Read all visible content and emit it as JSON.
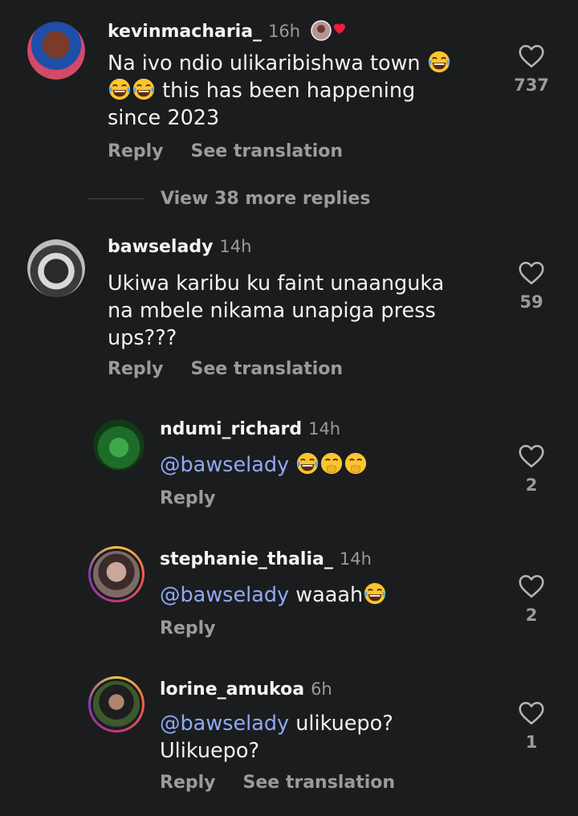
{
  "comments": [
    {
      "username": "kevinmacharia_",
      "time": "16h",
      "text_lines": [
        "Na ivo ndio ulikaribishwa town",
        "this has been happening",
        "since 2023"
      ],
      "likes": "737",
      "reply_label": "Reply",
      "translate_label": "See translation"
    },
    {
      "username": "bawselady",
      "time": "14h",
      "text": "Ukiwa karibu ku faint unaanguka na mbele nikama unapiga press ups???",
      "likes": "59",
      "reply_label": "Reply",
      "translate_label": "See translation"
    }
  ],
  "view_more_label": "View 38 more replies",
  "replies": [
    {
      "username": "ndumi_richard",
      "time": "14h",
      "mention": "@bawselady",
      "text": "",
      "likes": "2",
      "reply_label": "Reply"
    },
    {
      "username": "stephanie_thalia_",
      "time": "14h",
      "mention": "@bawselady",
      "text": "waaah",
      "likes": "2",
      "reply_label": "Reply"
    },
    {
      "username": "lorine_amukoa",
      "time": "6h",
      "mention": "@bawselady",
      "text": "ulikuepo?",
      "text2": "Ulikuepo?",
      "likes": "1",
      "reply_label": "Reply",
      "translate_label": "See translation"
    }
  ],
  "icons": {
    "like": "heart-outline-icon",
    "laugh": "face-with-tears-of-joy-emoji",
    "giggle": "face-with-hand-over-mouth-emoji"
  },
  "colors": {
    "background": "#1b1c1e",
    "mention": "#8fa9f7",
    "muted": "#9b9b9b"
  }
}
